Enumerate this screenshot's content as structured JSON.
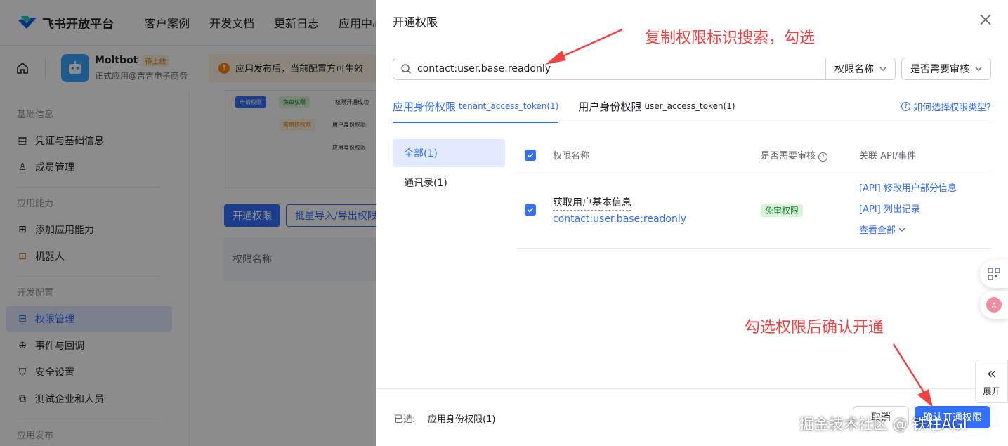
{
  "topnav": {
    "brand": "飞书开放平台",
    "links": [
      "客户案例",
      "开发文档",
      "更新日志",
      "应用中心"
    ]
  },
  "app": {
    "name": "Moltbot",
    "badge": "待上线",
    "subtitle": "正式应用@吉吉电子商务",
    "notice": "应用发布后，当前配置方可生效"
  },
  "sidebar": {
    "groups": [
      {
        "title": "基础信息",
        "items": [
          "凭证与基础信息",
          "成员管理"
        ]
      },
      {
        "title": "应用能力",
        "items": [
          "添加应用能力",
          "机器人"
        ]
      },
      {
        "title": "开发配置",
        "items": [
          "权限管理",
          "事件与回调",
          "安全设置",
          "测试企业和人员"
        ]
      },
      {
        "title": "应用发布",
        "items": []
      }
    ]
  },
  "main": {
    "flow": [
      "申请权限",
      "免审权限",
      "权限开通成功",
      "需审核权限",
      "用户身份权限",
      "应用身份权限"
    ],
    "btn_open": "开通权限",
    "btn_import": "批量导入/导出权限",
    "table_head": "权限名称"
  },
  "drawer": {
    "title": "开通权限",
    "search_value": "contact:user.base:readonly",
    "filter_1": "权限名称",
    "filter_2": "是否需要审核",
    "tabs": [
      {
        "label": "应用身份权限",
        "token": "tenant_access_token(1)"
      },
      {
        "label": "用户身份权限",
        "token": "user_access_token(1)"
      }
    ],
    "help": "如何选择权限类型?",
    "categories": [
      "全部(1)",
      "通讯录(1)"
    ],
    "table": {
      "headers": [
        "权限名称",
        "是否需要审核",
        "关联 API/事件"
      ],
      "rows": [
        {
          "name": "获取用户基本信息",
          "code": "contact:user.base:readonly",
          "review": "免审权限",
          "apis": [
            "[API] 修改用户部分信息",
            "[API] 列出记录"
          ],
          "more": "查看全部"
        }
      ]
    },
    "footer": {
      "selected_label": "已选:",
      "selected_value": "应用身份权限(1)",
      "cancel": "取消",
      "confirm": "确认开通权限"
    }
  },
  "side_widget": {
    "expand_label": "展开"
  },
  "annotations": {
    "top": "复制权限标识搜索，勾选",
    "bottom": "勾选权限后确认开通"
  },
  "watermark": "掘金技术社区 @ 铁柱AGI",
  "colors": {
    "accent": "#3370ff",
    "annotation": "#f04242",
    "success_bg": "#d9f5d6"
  }
}
